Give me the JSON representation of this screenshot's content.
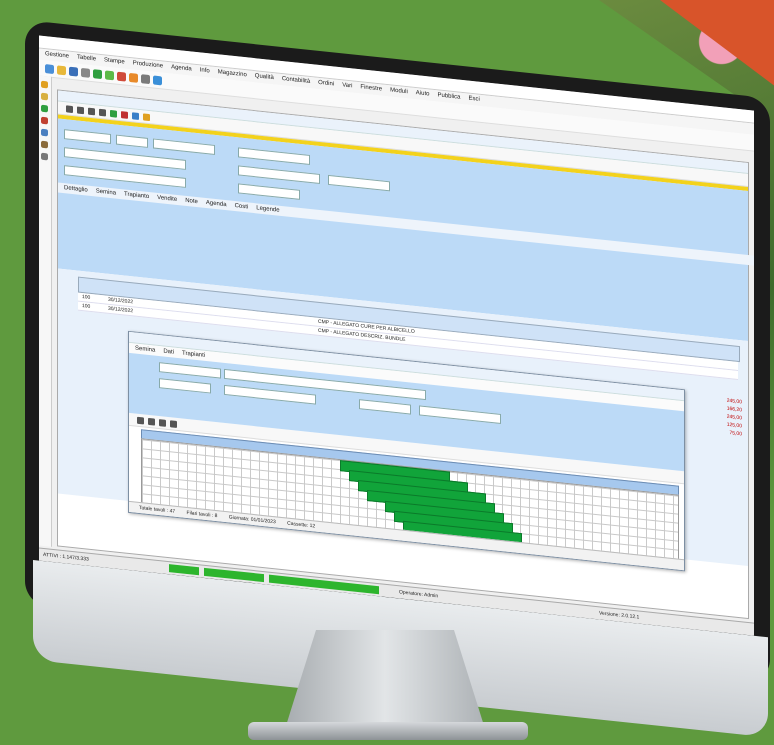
{
  "window": {
    "title": ""
  },
  "menu": {
    "items": [
      "Gestione",
      "Tabelle",
      "Stampe",
      "Produzione",
      "Agenda",
      "Info",
      "Magazzino",
      "Qualità",
      "Contabilità",
      "Ordini",
      "Vari",
      "Finestre",
      "Moduli",
      "Aiuto",
      "Pubblica",
      "Esci"
    ]
  },
  "inner_window": {
    "title": "",
    "tabs": [
      "Dettaglio",
      "Semina",
      "Trapianto",
      "Vendite",
      "Note",
      "Agenda",
      "Costi",
      "Legende"
    ]
  },
  "table": {
    "rows": [
      {
        "n": "100",
        "date": "30/12/2022",
        "desc": "CMP - ALLEGATO CURE PER ALBICELLO"
      },
      {
        "n": "100",
        "date": "30/12/2022",
        "desc": "CMP - ALLEGATO DESCRIZ. BUNDLE"
      }
    ],
    "red_values": [
      "245,00",
      "166,20",
      "245,00",
      "125,00",
      "75,00"
    ]
  },
  "popup": {
    "title": "",
    "tabs": [
      "Semina",
      "Dati",
      "Trapianti"
    ]
  },
  "popup_status": {
    "left": "Totale tavoli : 47",
    "mid": "Filari tavoli : 8",
    "right1": "Giornata: 01/01/2023",
    "right2": "Cassette: 12"
  },
  "status_bar": {
    "left": "ATTIVI : 1.147/3.333",
    "user": "Operatore: Admin",
    "right": "Versione: 2.0.12.1"
  },
  "colors": {
    "bg": "#5f9a3e",
    "gantt": "#11a43a",
    "form": "#bcdaf7",
    "accent_yellow": "#f3d21c"
  }
}
